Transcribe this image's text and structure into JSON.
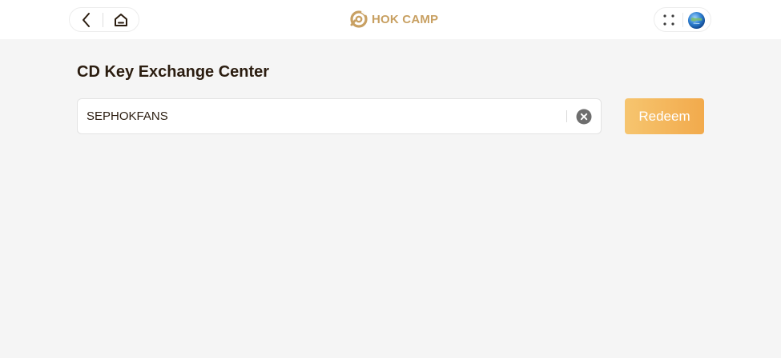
{
  "header": {
    "brand": "HOK CAMP",
    "icons": {
      "back": "chevron-left-icon",
      "home": "home-icon",
      "menu": "grid-dots-icon",
      "avatar": "globe-avatar-icon"
    }
  },
  "main": {
    "title": "CD Key Exchange Center",
    "cd_key_input": {
      "value": "SEPHOKFANS",
      "placeholder": ""
    },
    "redeem_label": "Redeem"
  },
  "colors": {
    "brand": "#c8a062",
    "button_gradient_start": "#f6c56f",
    "button_gradient_end": "#f2aa4c",
    "title_text": "#2b1d10",
    "background": "#f5f5f5"
  }
}
